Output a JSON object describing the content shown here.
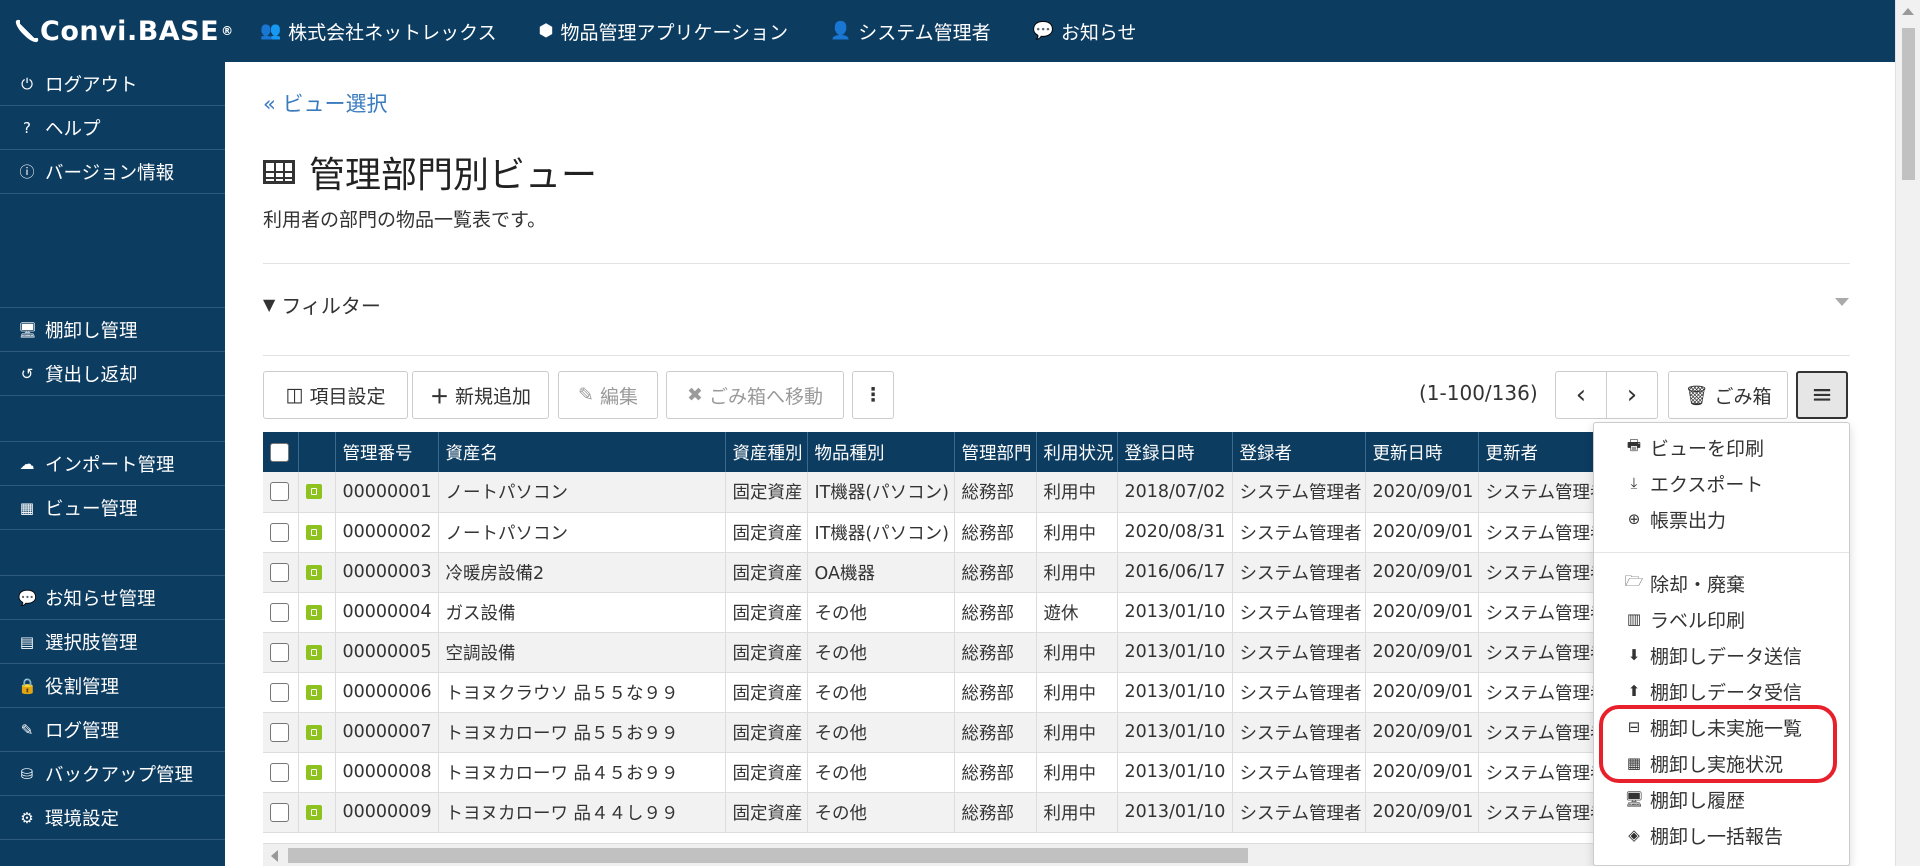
{
  "brand": {
    "name": "Convi.BASE",
    "reg": "®"
  },
  "topnav": [
    {
      "icon": "users-icon",
      "glyph": "👥",
      "label": "株式会社ネットレックス"
    },
    {
      "icon": "cube-icon",
      "glyph": "⬢",
      "label": "物品管理アプリケーション"
    },
    {
      "icon": "user-icon",
      "glyph": "👤",
      "label": "システム管理者"
    },
    {
      "icon": "comment-icon",
      "glyph": "💬",
      "label": "お知らせ"
    }
  ],
  "sidebar": {
    "items": [
      {
        "glyph": "⏻",
        "label": "ログアウト"
      },
      {
        "glyph": "?",
        "label": "ヘルプ"
      },
      {
        "glyph": "ⓘ",
        "label": "バージョン情報"
      },
      {
        "glyph": "🖥",
        "label": "棚卸し管理"
      },
      {
        "glyph": "↺",
        "label": "貸出し返却"
      },
      {
        "glyph": "☁",
        "label": "インポート管理"
      },
      {
        "glyph": "▦",
        "label": "ビュー管理"
      },
      {
        "glyph": "💬",
        "label": "お知らせ管理"
      },
      {
        "glyph": "▤",
        "label": "選択肢管理"
      },
      {
        "glyph": "🔒",
        "label": "役割管理"
      },
      {
        "glyph": "✎",
        "label": "ログ管理"
      },
      {
        "glyph": "⛁",
        "label": "バックアップ管理"
      },
      {
        "glyph": "⚙",
        "label": "環境設定"
      }
    ]
  },
  "main": {
    "back_link": "« ビュー選択",
    "title": "管理部門別ビュー",
    "description": "利用者の部門の物品一覧表です。",
    "filter_label": "フィルター"
  },
  "toolbar": {
    "columns_label": "項目設定",
    "add_label": "新規追加",
    "edit_label": "編集",
    "trash_move_label": "ごみ箱へ移動",
    "more_label": "⋮",
    "pager_text": "(1-100/136)",
    "prev_label": "‹",
    "next_label": "›",
    "trash_label": "ごみ箱",
    "menu_label": "≡"
  },
  "table": {
    "headers": [
      "",
      "",
      "管理番号",
      "資産名",
      "資産種別",
      "物品種別",
      "管理部門",
      "利用状況",
      "登録日時",
      "登録者",
      "更新日時",
      "更新者"
    ],
    "rows": [
      [
        "00000001",
        "ノートパソコン",
        "固定資産",
        "IT機器(パソコン)",
        "総務部",
        "利用中",
        "2018/07/02",
        "システム管理者",
        "2020/09/01",
        "システム管理者"
      ],
      [
        "00000002",
        "ノートパソコン",
        "固定資産",
        "IT機器(パソコン)",
        "総務部",
        "利用中",
        "2020/08/31",
        "システム管理者",
        "2020/09/01",
        "システム管理者"
      ],
      [
        "00000003",
        "冷暖房設備2",
        "固定資産",
        "OA機器",
        "総務部",
        "利用中",
        "2016/06/17",
        "システム管理者",
        "2020/09/01",
        "システム管理者"
      ],
      [
        "00000004",
        "ガス設備",
        "固定資産",
        "その他",
        "総務部",
        "遊休",
        "2013/01/10",
        "システム管理者",
        "2020/09/01",
        "システム管理者"
      ],
      [
        "00000005",
        "空調設備",
        "固定資産",
        "その他",
        "総務部",
        "利用中",
        "2013/01/10",
        "システム管理者",
        "2020/09/01",
        "システム管理者"
      ],
      [
        "00000006",
        "トヨヌクラウソ 品５５な９９",
        "固定資産",
        "その他",
        "総務部",
        "利用中",
        "2013/01/10",
        "システム管理者",
        "2020/09/01",
        "システム管理者"
      ],
      [
        "00000007",
        "トヨヌカローワ 品５５お９９",
        "固定資産",
        "その他",
        "総務部",
        "利用中",
        "2013/01/10",
        "システム管理者",
        "2020/09/01",
        "システム管理者"
      ],
      [
        "00000008",
        "トヨヌカローワ 品４５お９９",
        "固定資産",
        "その他",
        "総務部",
        "利用中",
        "2013/01/10",
        "システム管理者",
        "2020/09/01",
        "システム管理者"
      ],
      [
        "00000009",
        "トヨヌカローワ 品４４し９９",
        "固定資産",
        "その他",
        "総務部",
        "利用中",
        "2013/01/10",
        "システム管理者",
        "2020/09/01",
        "システム管理者"
      ]
    ]
  },
  "dropdown": {
    "items": [
      {
        "glyph": "🖶",
        "label": "ビューを印刷"
      },
      {
        "glyph": "⤓",
        "label": "エクスポート"
      },
      {
        "glyph": "⊕",
        "label": "帳票出力"
      },
      {
        "glyph": "🗁",
        "label": "除却・廃棄"
      },
      {
        "glyph": "▥",
        "label": "ラベル印刷"
      },
      {
        "glyph": "⬇",
        "label": "棚卸しデータ送信"
      },
      {
        "glyph": "⬆",
        "label": "棚卸しデータ受信"
      },
      {
        "glyph": "⊟",
        "label": "棚卸し未実施一覧"
      },
      {
        "glyph": "▦",
        "label": "棚卸し実施状況"
      },
      {
        "glyph": "🖥",
        "label": "棚卸し履歴"
      },
      {
        "glyph": "◈",
        "label": "棚卸し一括報告"
      }
    ]
  },
  "colors": {
    "nav": "#0d3c61",
    "link": "#3a7bbf",
    "highlight": "#e8202c",
    "lock": "#8dc21f"
  }
}
